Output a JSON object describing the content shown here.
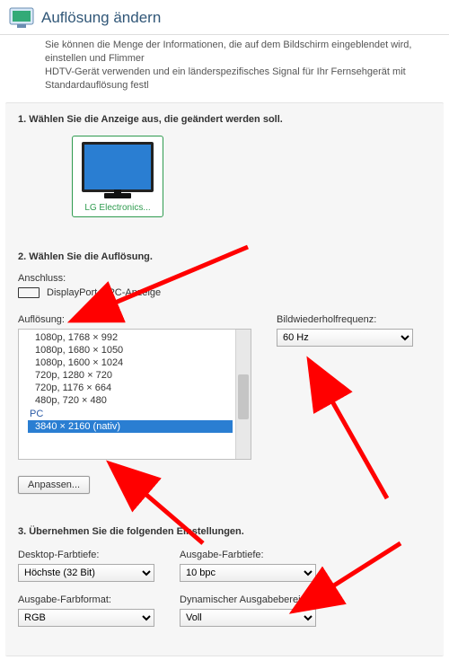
{
  "header": {
    "title": "Auflösung ändern"
  },
  "intro": {
    "line1": "Sie können die Menge der Informationen, die auf dem Bildschirm eingeblendet wird, einstellen und Flimmer",
    "line2": "HDTV-Gerät verwenden und ein länderspezifisches Signal für Ihr Fernsehgerät mit Standardauflösung festl"
  },
  "step1": {
    "title": "1. Wählen Sie die Anzeige aus, die geändert werden soll.",
    "monitor_label": "LG Electronics..."
  },
  "step2": {
    "title": "2. Wählen Sie die Auflösung.",
    "port_label": "Anschluss:",
    "port_value": "DisplayPort – PC-Anzeige",
    "res_label": "Auflösung:",
    "refresh_label": "Bildwiederholfrequenz:",
    "refresh_value": "60 Hz",
    "list": {
      "items": [
        "1080p, 1768 × 992",
        "1080p, 1680 × 1050",
        "1080p, 1600 × 1024",
        "720p, 1280 × 720",
        "720p, 1176 × 664",
        "480p, 720 × 480"
      ],
      "category": "PC",
      "selected": "3840 × 2160 (nativ)"
    },
    "adjust_btn": "Anpassen..."
  },
  "step3": {
    "title": "3. Übernehmen Sie die folgenden Einstellungen.",
    "desktop_depth_label": "Desktop-Farbtiefe:",
    "desktop_depth_value": "Höchste (32 Bit)",
    "output_depth_label": "Ausgabe-Farbtiefe:",
    "output_depth_value": "10 bpc",
    "output_format_label": "Ausgabe-Farbformat:",
    "output_format_value": "RGB",
    "dyn_range_label": "Dynamischer Ausgabebereich:",
    "dyn_range_value": "Voll"
  }
}
